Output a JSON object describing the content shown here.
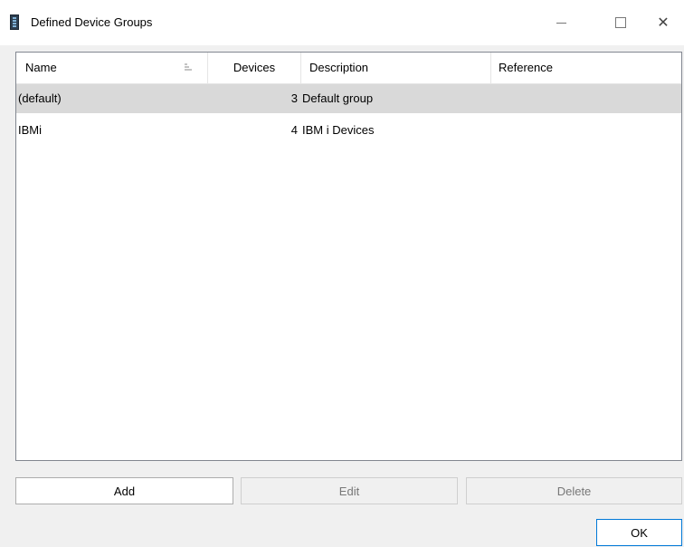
{
  "window": {
    "title": "Defined Device Groups",
    "icon": "app-icon"
  },
  "controls": {
    "minimize_icon": "minimize-icon",
    "maximize_icon": "maximize-icon",
    "close_glyph": "✕"
  },
  "table": {
    "columns": [
      "Name",
      "Devices",
      "Description",
      "Reference"
    ],
    "sort_icon": "sort-icon",
    "rows": [
      {
        "name": "(default)",
        "devices": "3",
        "description": "Default group",
        "reference": "",
        "selected": true
      },
      {
        "name": "IBMi",
        "devices": "4",
        "description": "IBM i  Devices",
        "reference": "",
        "selected": false
      }
    ]
  },
  "buttons": {
    "add": "Add",
    "edit": "Edit",
    "delete": "Delete",
    "ok": "OK"
  },
  "colors": {
    "selected_row": "#d9d9d9",
    "ok_border": "#0078d7"
  }
}
